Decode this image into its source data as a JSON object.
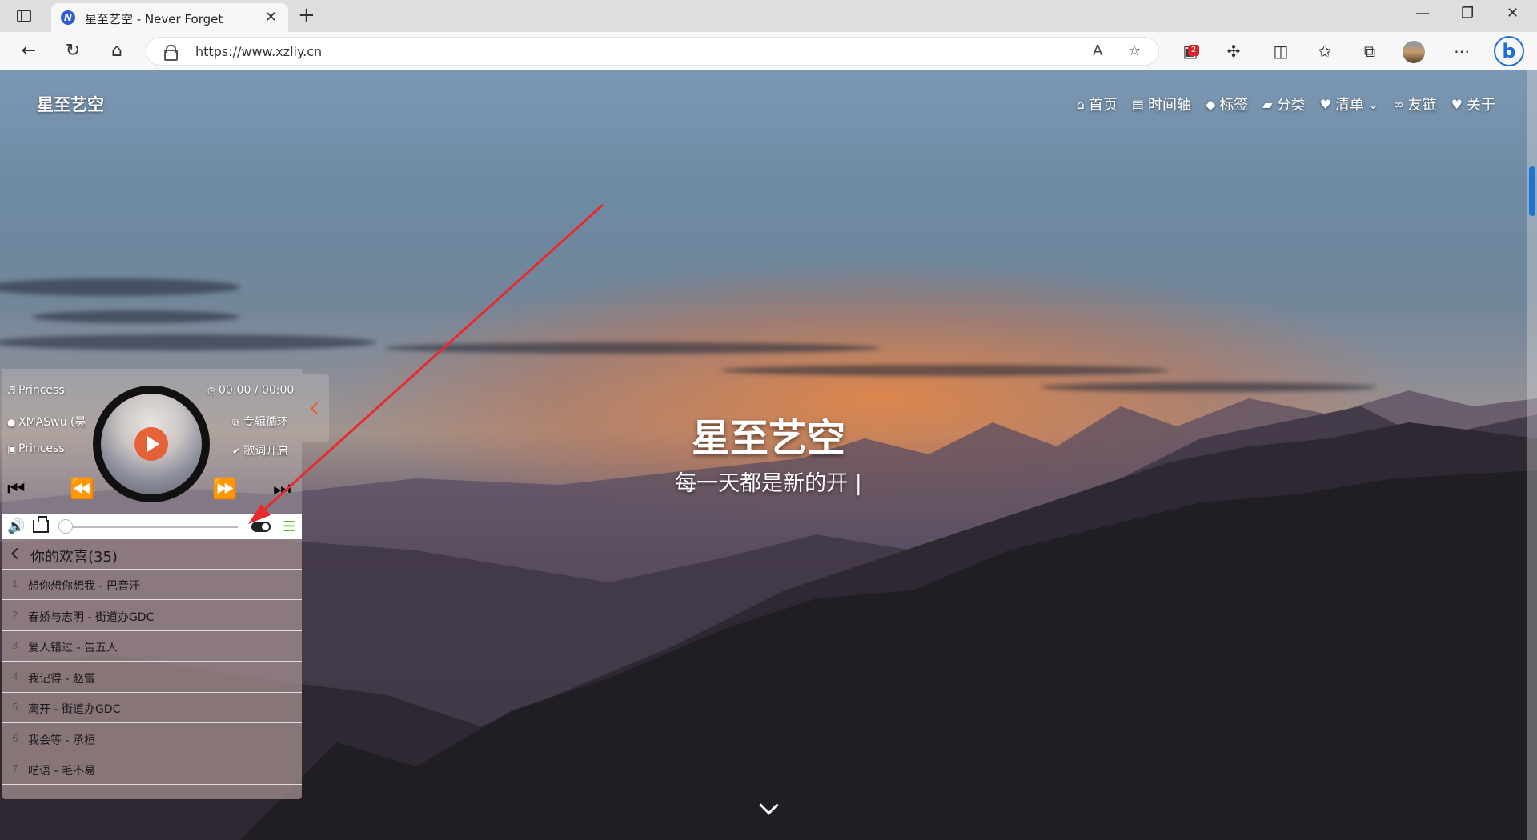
{
  "browser": {
    "tab_title": "星至艺空 - Never Forget",
    "tab_favicon_letter": "N",
    "url": "https://www.xzliy.cn",
    "extension_badge": "2"
  },
  "site": {
    "logo": "星至艺空",
    "nav": [
      {
        "icon": "home-icon",
        "label": "首页"
      },
      {
        "icon": "archive-icon",
        "label": "时间轴"
      },
      {
        "icon": "tag-icon",
        "label": "标签"
      },
      {
        "icon": "folder-icon",
        "label": "分类"
      },
      {
        "icon": "heart-list-icon",
        "label": "清单"
      },
      {
        "icon": "link-icon",
        "label": "友链"
      },
      {
        "icon": "heart-icon",
        "label": "关于"
      }
    ],
    "hero_title": "星至艺空",
    "hero_subtitle": "每一天都是新的开 |"
  },
  "player": {
    "song_title": "Princess",
    "artist": "XMASwu (吴",
    "album": "Princess",
    "time": "00:00 / 00:00",
    "mode": "专辑循环",
    "lyrics": "歌词开启",
    "progress": 0,
    "playlist_title": "你的欢喜(35)",
    "songs": [
      {
        "num": "1",
        "name": "想你想你想我 - 巴音汗"
      },
      {
        "num": "2",
        "name": "春娇与志明 - 街道办GDC"
      },
      {
        "num": "3",
        "name": "爱人错过 - 告五人"
      },
      {
        "num": "4",
        "name": "我记得 - 赵雷"
      },
      {
        "num": "5",
        "name": "离开 - 街道办GDC"
      },
      {
        "num": "6",
        "name": "我会等 - 承桓"
      },
      {
        "num": "7",
        "name": "呓语 - 毛不易"
      }
    ]
  },
  "colors": {
    "accent_play": "#e85528",
    "list_icon": "#5cb82f",
    "annotation_arrow": "#e8292e",
    "scroll_thumb": "#1976d2"
  }
}
